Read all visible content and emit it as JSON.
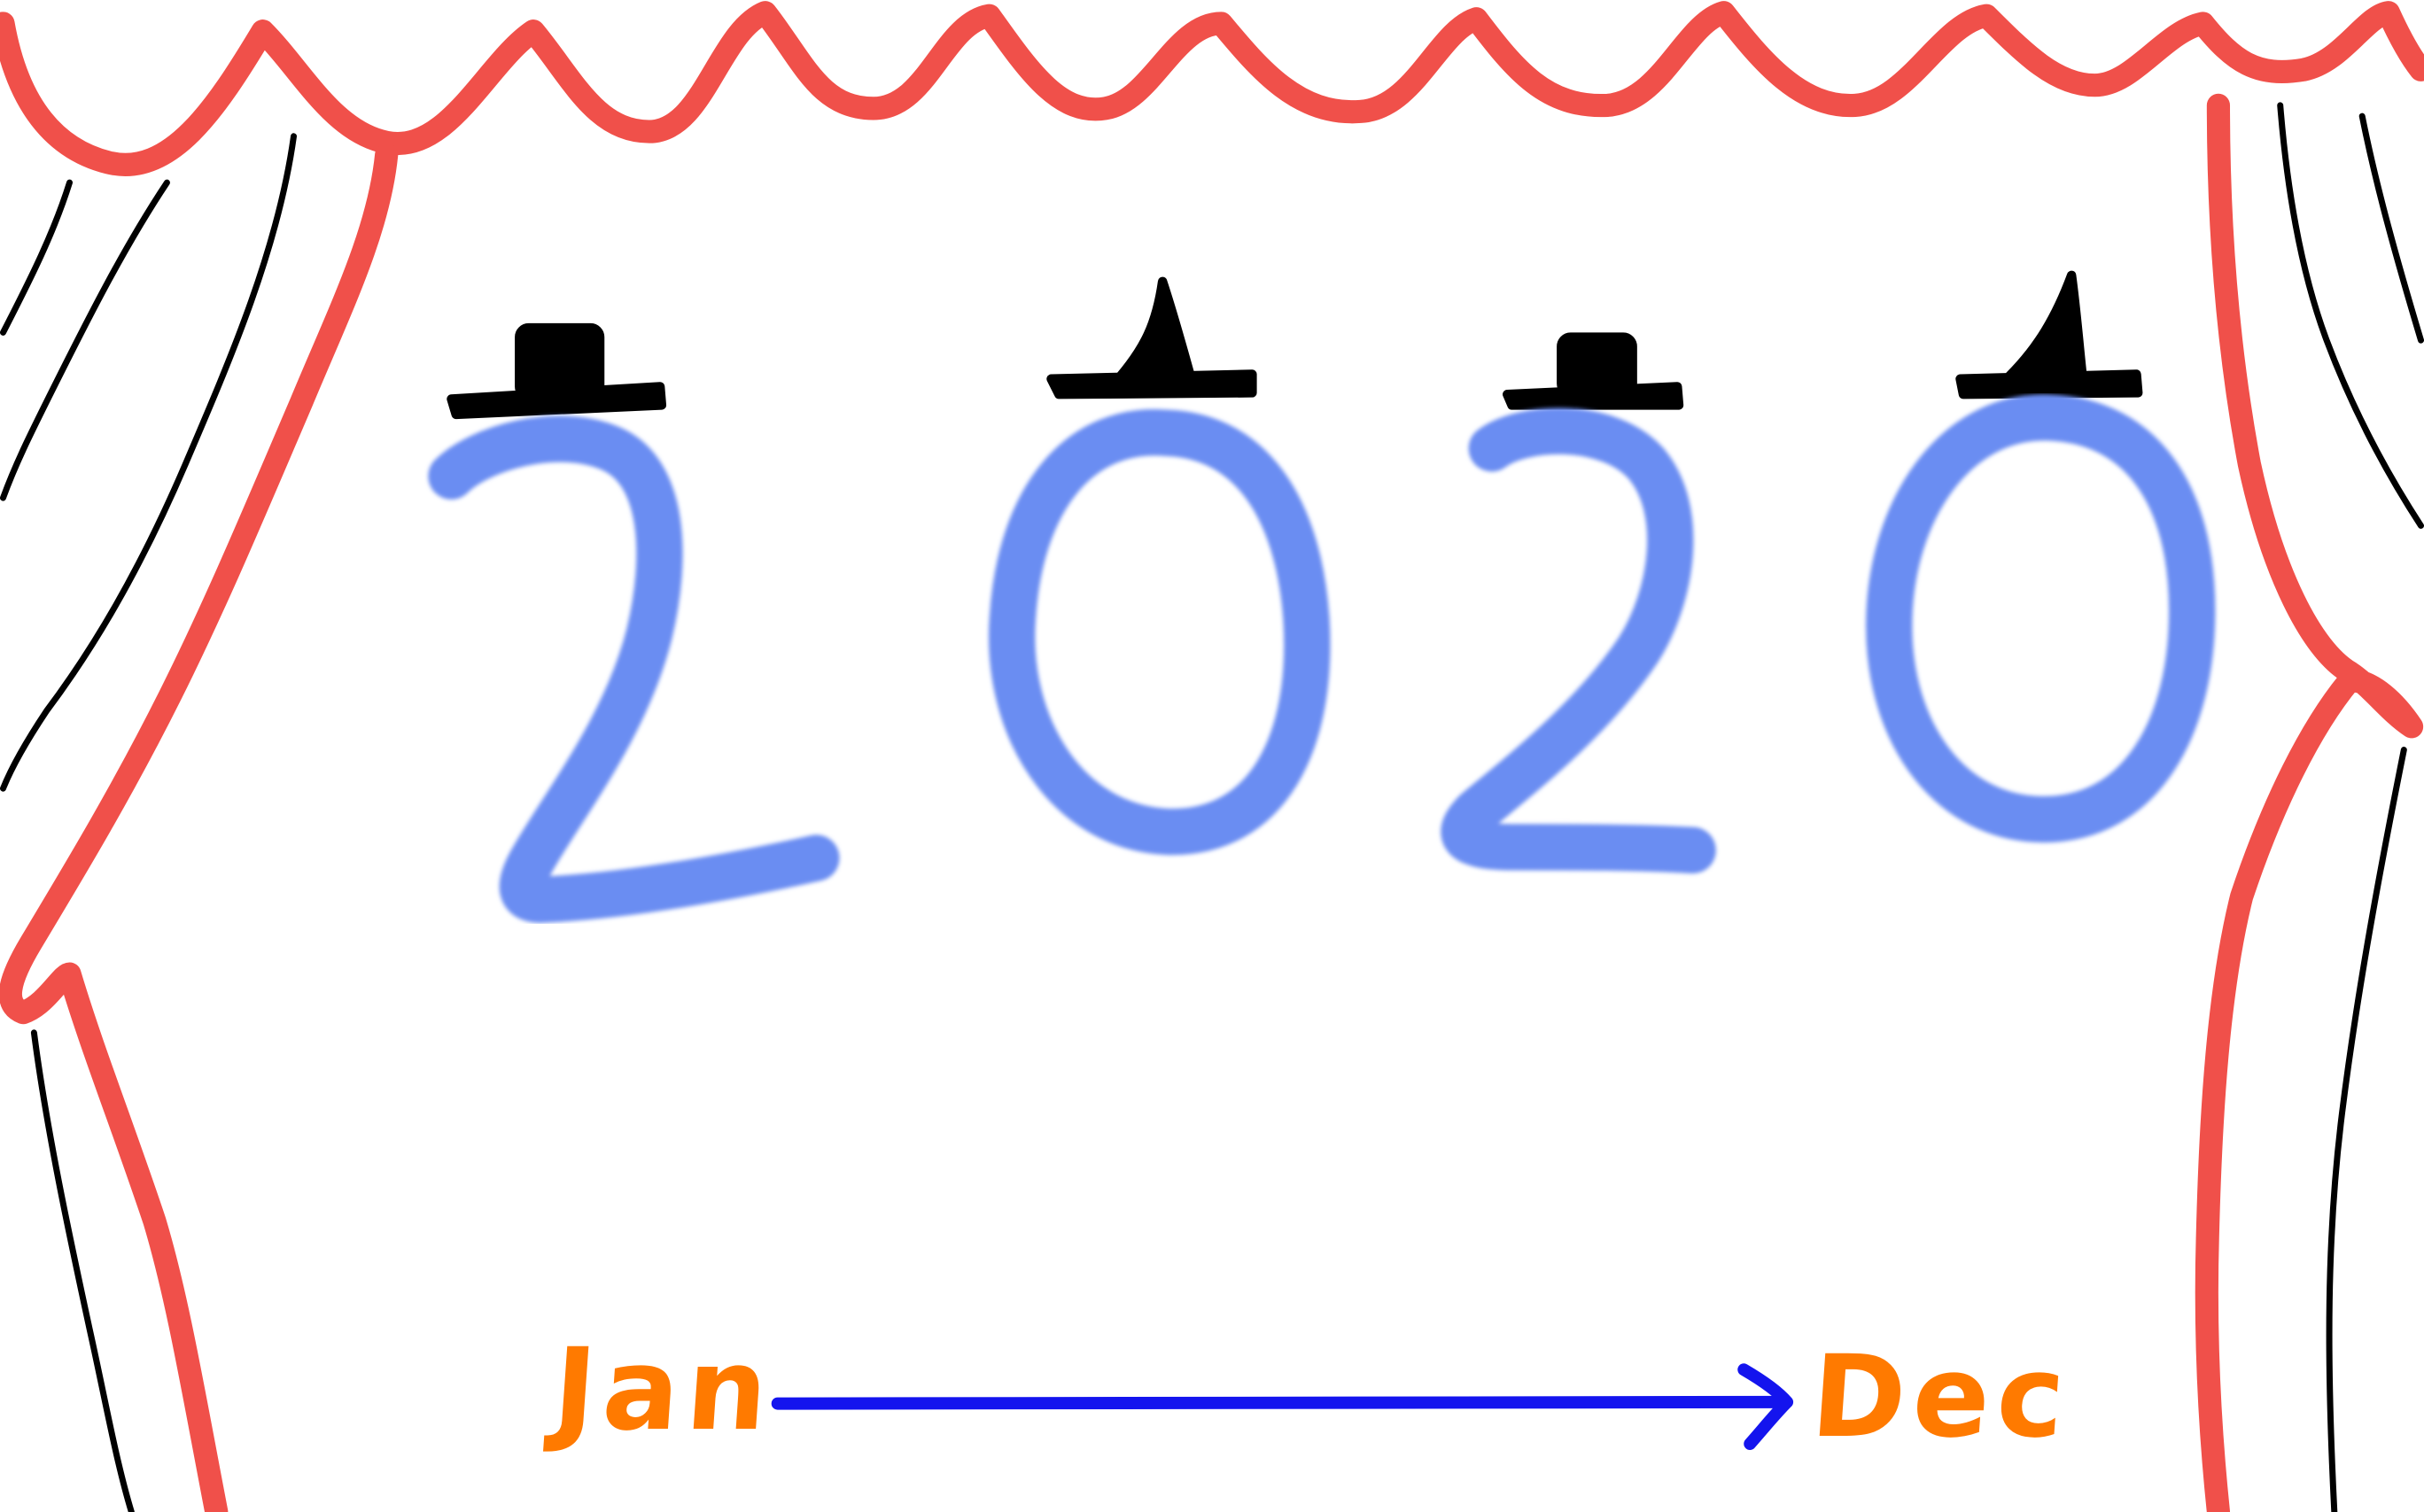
{
  "drawing": {
    "year_digits": [
      "2",
      "0",
      "2",
      "0"
    ],
    "start_label": "Jan",
    "end_label": "Dec",
    "colors": {
      "curtain": "#f0504a",
      "curtain_folds": "#000000",
      "digits": "#6b8df2",
      "hats": "#000000",
      "month_labels": "#ff7a00",
      "arrow": "#1414ee"
    },
    "hats": [
      "top-hat",
      "witch-hat",
      "top-hat",
      "witch-hat"
    ]
  }
}
